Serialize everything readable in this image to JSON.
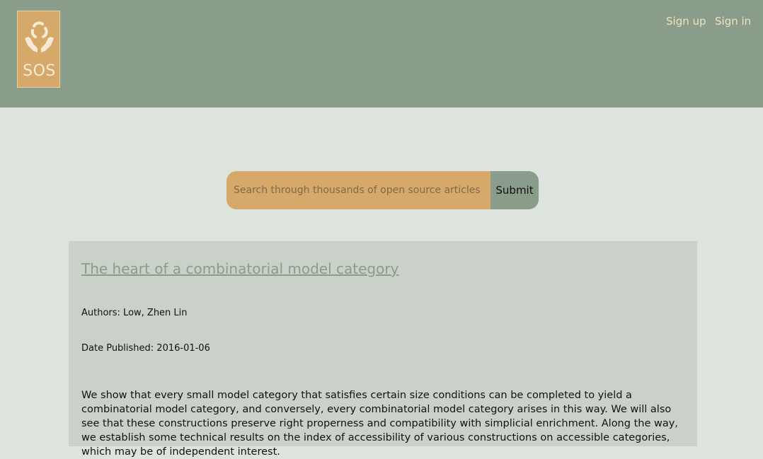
{
  "header": {
    "logo_text": "SOS",
    "signup_label": "Sign up",
    "signin_label": "Sign in"
  },
  "search": {
    "placeholder": "Search through thousands of open source articles",
    "submit_label": "Submit"
  },
  "results": [
    {
      "title": "The heart of a combinatorial model category",
      "authors": "Authors: Low, Zhen Lin",
      "date_published": "Date Published: 2016-01-06",
      "abstract": "We show that every small model category that satisfies certain size conditions can be completed to yield a combinatorial model category, and conversely, every combinatorial model category arises in this way. We will also see that these constructions preserve right properness and compatibility with simplicial enrichment. Along the way, we establish some technical results on the index of accessibility of various constructions on accessible categories, which may be of independent interest."
    }
  ],
  "colors": {
    "header_bg": "#8a9c8a",
    "page_bg": "#dce4dd",
    "accent_gold": "#d6a96b",
    "card_bg": "#c9d1c9",
    "link_cream": "#f1e3bf"
  }
}
